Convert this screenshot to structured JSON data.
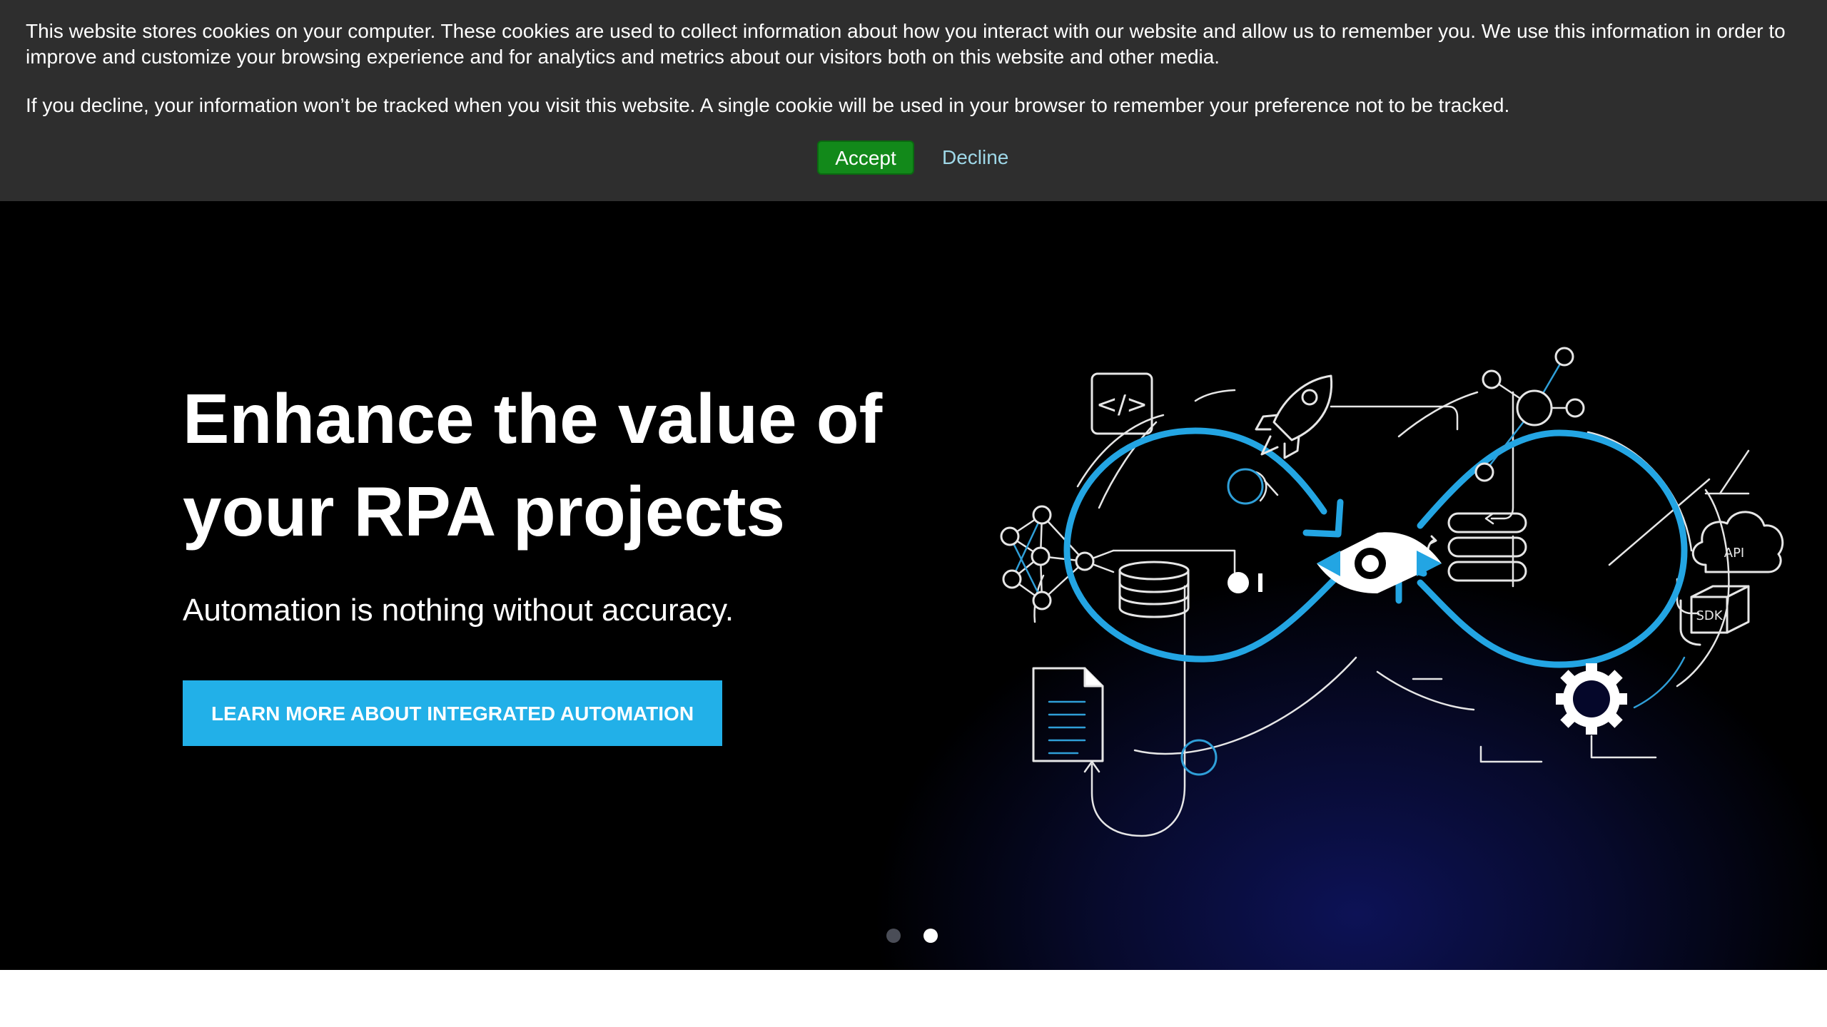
{
  "cookie_banner": {
    "paragraph_1": "This website stores cookies on your computer. These cookies are used to collect information about how you interact with our website and allow us to remember you. We use this information in order to improve and customize your browsing experience and for analytics and metrics about our visitors both on this website and other media.",
    "paragraph_2": "If you decline, your information won’t be tracked when you visit this website. A single cookie will be used in your browser to remember your preference not to be tracked.",
    "accept_label": "Accept",
    "decline_label": "Decline",
    "colors": {
      "background": "#2e2e2e",
      "accept": "#12891a",
      "decline_text": "#9fd8e8"
    }
  },
  "hero": {
    "title": "Enhance the value of your RPA projects",
    "subtitle": "Automation is nothing without accuracy.",
    "cta_label": "LEARN MORE ABOUT INTEGRATED AUTOMATION",
    "illustration": {
      "api_label": "API",
      "sdk_label": "SDK",
      "code_label": "</>",
      "icons": [
        "code-icon",
        "rocket-icon",
        "network-icon",
        "database-icon",
        "document-icon",
        "cloud-icon",
        "sdk-cube-icon",
        "gear-icon",
        "eye-logo-icon",
        "infinity-loop-icon"
      ]
    },
    "carousel": {
      "slide_count": 2,
      "active_slide": 2
    },
    "colors": {
      "accent": "#22b0e8",
      "text": "#ffffff",
      "background": "#000000"
    }
  }
}
